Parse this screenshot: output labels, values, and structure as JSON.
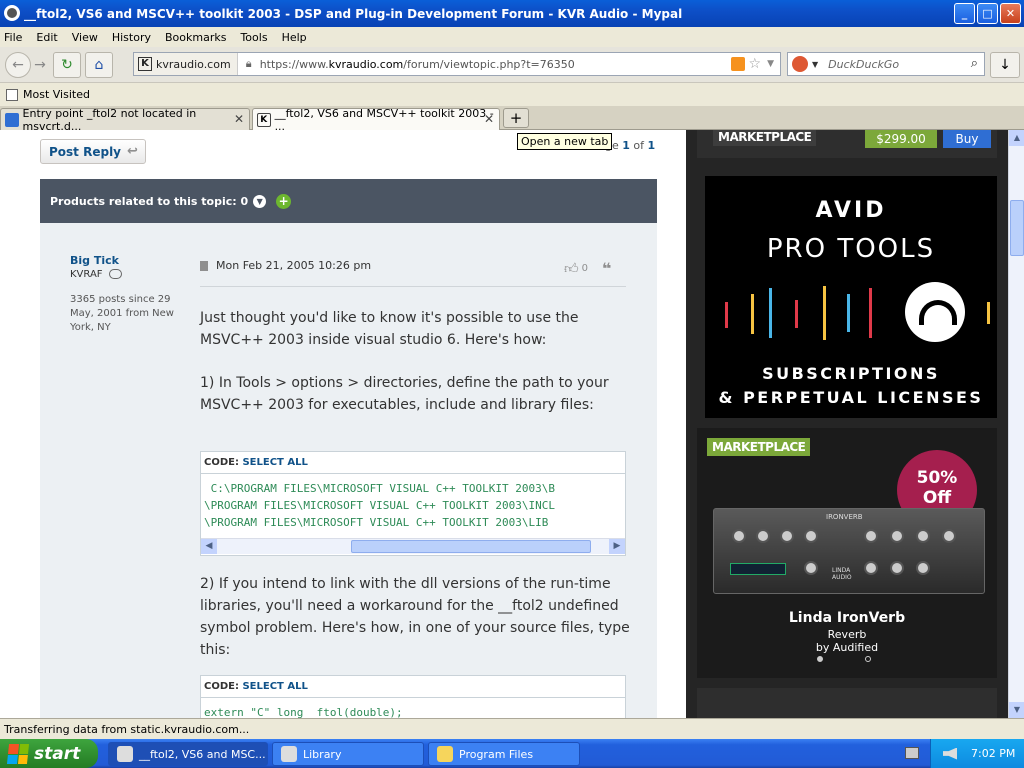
{
  "window": {
    "title": "__ftol2, VS6 and MSCV++ toolkit 2003 - DSP and Plug-in Development Forum - KVR Audio - Mypal",
    "min_label": "_",
    "max_label": "□",
    "close_label": "✕"
  },
  "menu": [
    "File",
    "Edit",
    "View",
    "History",
    "Bookmarks",
    "Tools",
    "Help"
  ],
  "nav": {
    "site_label": "kvraudio.com",
    "url_prefix": "https://www.",
    "url_domain": "kvraudio.com",
    "url_path": "/forum/viewtopic.php?t=76350",
    "search_placeholder": "DuckDuckGo"
  },
  "bookmarks": {
    "most_visited": "Most Visited"
  },
  "tabs": [
    {
      "label": "Entry point _ftol2 not located in msvcrt.d...",
      "active": false
    },
    {
      "label": "__ftol2, VS6 and MSCV++ toolkit 2003 - ...",
      "active": true
    }
  ],
  "tooltip": "Open a new tab",
  "forum": {
    "post_reply": "Post Reply",
    "page_prefix": "ge",
    "page_current": "1",
    "page_of": "of",
    "page_total": "1",
    "related": "Products related to this topic: 0",
    "author": "Big Tick",
    "rank": "KVRAF",
    "author_info": "3365 posts since 29 May, 2001 from New York, NY",
    "date": "Mon Feb 21, 2005 10:26 pm",
    "likes": "0",
    "para1": "Just thought you'd like to know it's possible to use the MSVC++ 2003 inside visual studio 6. Here's how:",
    "para2": "1) In Tools > options > directories, define the path to your MSVC++ 2003 for executables, include and library files:",
    "code1_head_label": "CODE:",
    "code1_head_action": "SELECT ALL",
    "code1_lines": [
      " C:\\PROGRAM FILES\\MICROSOFT VISUAL C++ TOOLKIT 2003\\B",
      "\\PROGRAM FILES\\MICROSOFT VISUAL C++ TOOLKIT 2003\\INCL",
      "\\PROGRAM FILES\\MICROSOFT VISUAL C++ TOOLKIT 2003\\LIB"
    ],
    "para3": "2) If you intend to link with the dll versions of the run-time libraries, you'll need a workaround for the __ftol2 undefined symbol problem. Here's how, in one of your source files, type this:",
    "code2_head_label": "CODE:",
    "code2_head_action": "SELECT ALL",
    "code2_line": "extern \"C\" long _ftol(double);"
  },
  "ads": {
    "market_label": "MARKETPLACE",
    "price": "$299.00",
    "buy": "Buy",
    "avid": "AVID",
    "pro_tools": "PRO TOOLS",
    "pro_tools_sub1": "SUBSCRIPTIONS",
    "pro_tools_sub2": "& PERPETUAL LICENSES",
    "market_label2": "MARKETPLACE",
    "discount_pct": "50%",
    "discount_off": "Off",
    "device_name": "IRONVERB",
    "device_brand": "LINDA AUDIO",
    "product_title": "Linda IronVerb",
    "product_type": "Reverb",
    "product_by": "by Audified"
  },
  "status": "Transferring data from static.kvraudio.com...",
  "taskbar": {
    "start": "start",
    "tasks": [
      "__ftol2, VS6 and MSC...",
      "Library",
      "Program Files"
    ],
    "clock": "7:02 PM"
  }
}
